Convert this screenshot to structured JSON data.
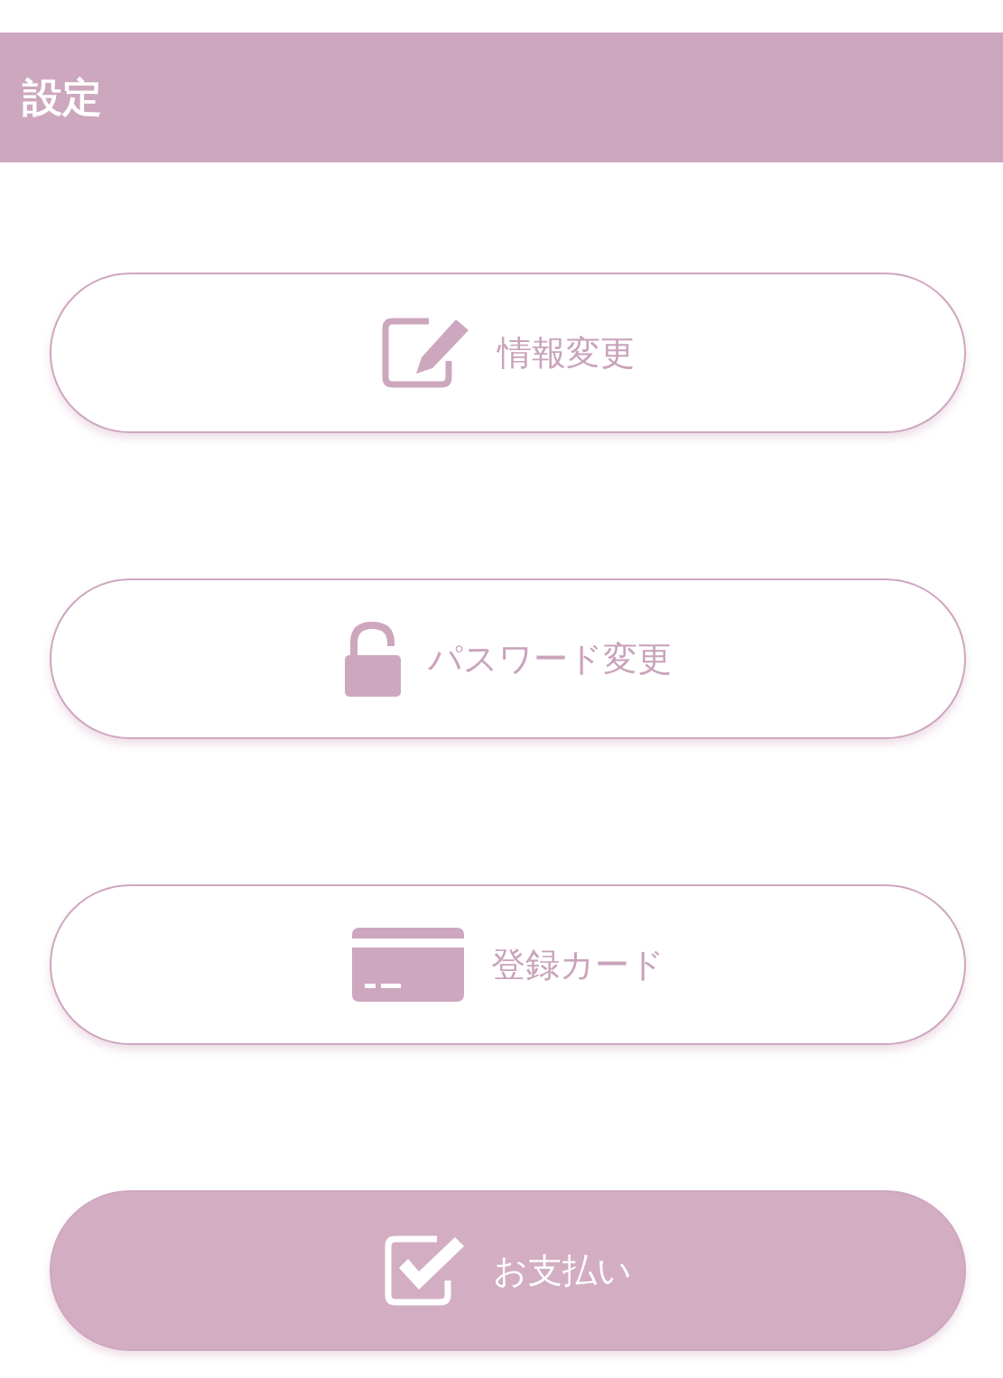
{
  "header": {
    "title": "設定"
  },
  "buttons": [
    {
      "label": "情報変更",
      "kind": "outline"
    },
    {
      "label": "パスワード変更",
      "kind": "outline"
    },
    {
      "label": "登録カード",
      "kind": "outline"
    },
    {
      "label": "お支払い",
      "kind": "filled"
    }
  ]
}
